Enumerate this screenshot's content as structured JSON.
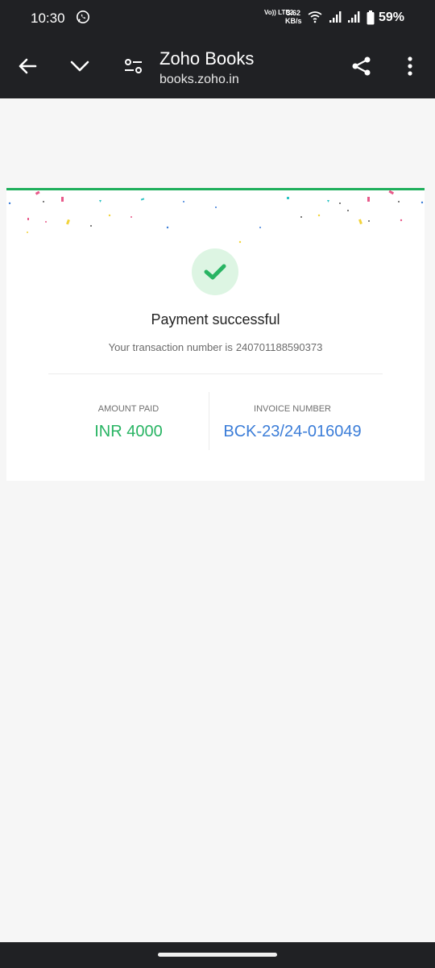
{
  "status_bar": {
    "time": "10:30",
    "network": "Vo)) LTE2",
    "speed_value": "3.62",
    "speed_unit": "KB/s",
    "battery": "59%"
  },
  "toolbar": {
    "title": "Zoho Books",
    "url": "books.zoho.in",
    "icons": [
      "back-arrow-icon",
      "chevron-down-icon",
      "site-settings-icon",
      "share-icon",
      "more-vertical-icon"
    ]
  },
  "receipt": {
    "title": "Payment successful",
    "transaction_prefix": "Your transaction number is",
    "transaction_number": "240701188590373",
    "amount_label": "AMOUNT PAID",
    "amount_value": "INR 4000",
    "invoice_label": "INVOICE NUMBER",
    "invoice_value": "BCK-23/24-016049"
  },
  "colors": {
    "accent_green": "#1faf5c",
    "amount_green": "#28b463",
    "invoice_blue": "#3b7dd8",
    "check_bg": "#ddf5e3",
    "toolbar_bg": "#202124"
  }
}
